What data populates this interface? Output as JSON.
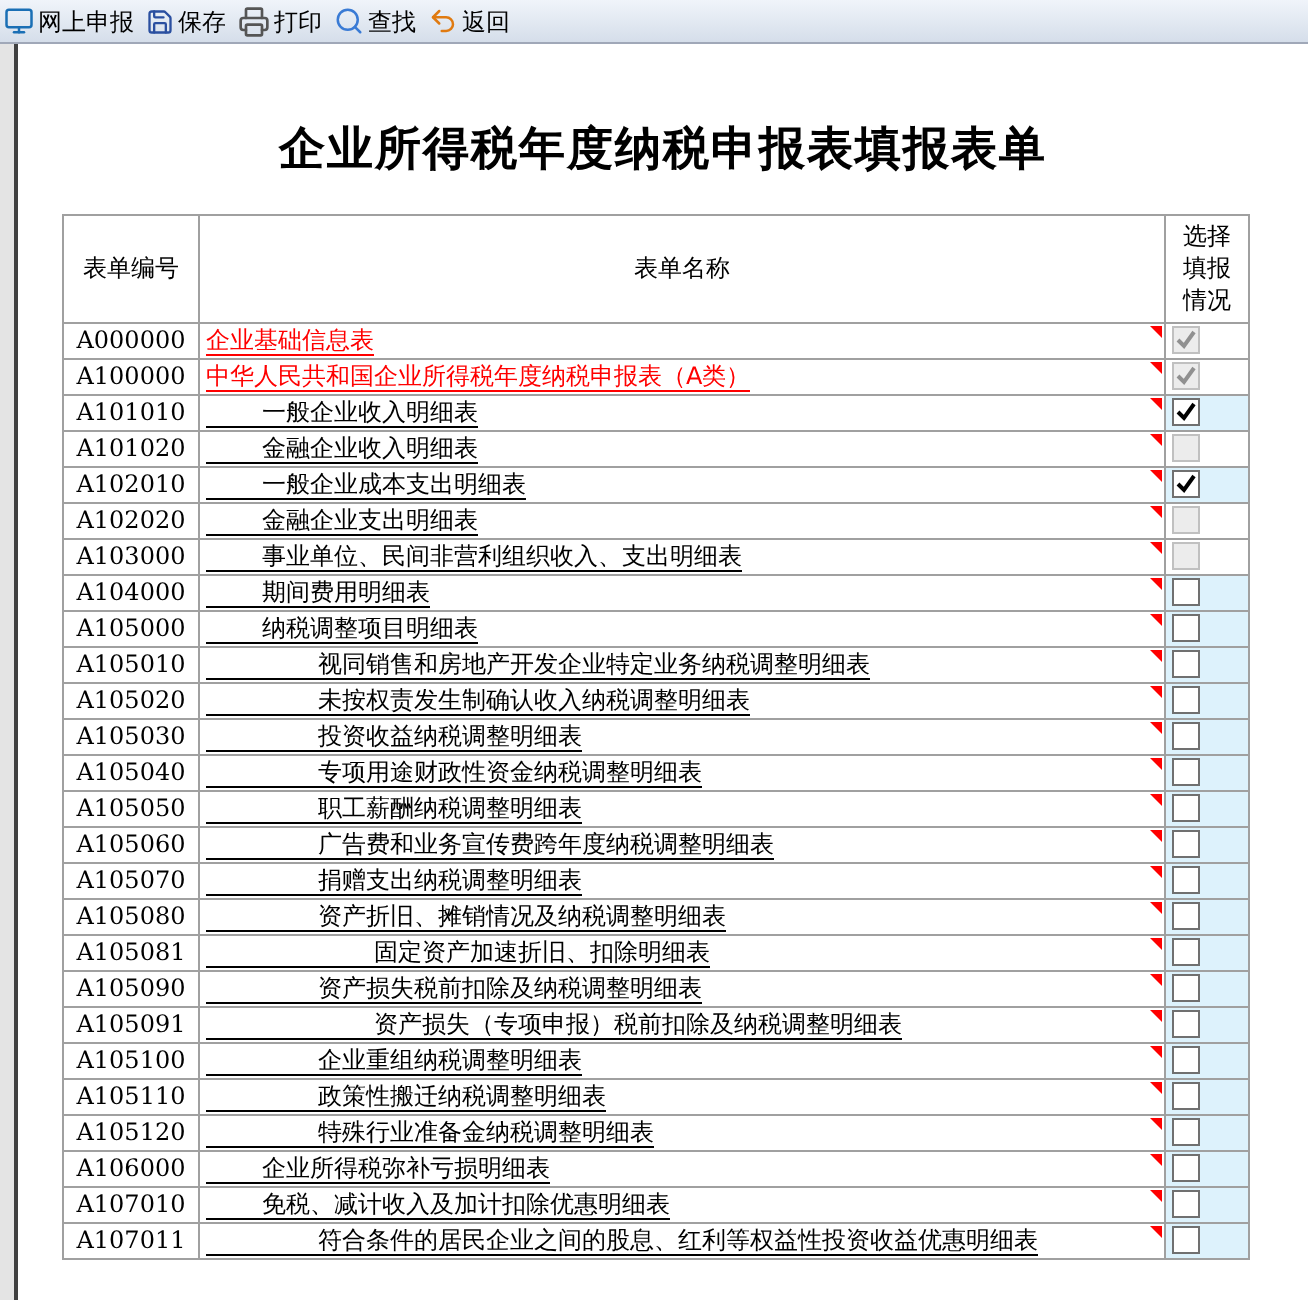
{
  "toolbar": [
    {
      "label": "网上申报",
      "kind": "submit"
    },
    {
      "label": "保存",
      "kind": "save"
    },
    {
      "label": "打印",
      "kind": "print"
    },
    {
      "label": "查找",
      "kind": "search"
    },
    {
      "label": "返回",
      "kind": "back"
    }
  ],
  "title": "企业所得税年度纳税申报表填报表单",
  "table": {
    "columns": [
      "表单编号",
      "表单名称",
      "选择填报情况"
    ],
    "rows": [
      {
        "code": "A000000",
        "name": "企业基础信息表",
        "checked": true,
        "disabled": true
      },
      {
        "code": "A100000",
        "name": "中华人民共和国企业所得税年度纳税申报表（A类）",
        "checked": true,
        "disabled": true,
        "children": [
          {
            "code": "A101010",
            "name": "一般企业收入明细表",
            "checked": true,
            "disabled": false
          },
          {
            "code": "A101020",
            "name": "金融企业收入明细表",
            "checked": false,
            "disabled": true
          },
          {
            "code": "A102010",
            "name": "一般企业成本支出明细表",
            "checked": true,
            "disabled": false
          },
          {
            "code": "A102020",
            "name": "金融企业支出明细表",
            "checked": false,
            "disabled": true
          },
          {
            "code": "A103000",
            "name": "事业单位、民间非营利组织收入、支出明细表",
            "checked": false,
            "disabled": true
          },
          {
            "code": "A104000",
            "name": "期间费用明细表",
            "checked": false,
            "disabled": false
          },
          {
            "code": "A105000",
            "name": "纳税调整项目明细表",
            "checked": false,
            "disabled": false,
            "children": [
              {
                "code": "A105010",
                "name": "视同销售和房地产开发企业特定业务纳税调整明细表",
                "checked": false,
                "disabled": false
              },
              {
                "code": "A105020",
                "name": "未按权责发生制确认收入纳税调整明细表",
                "checked": false,
                "disabled": false
              },
              {
                "code": "A105030",
                "name": "投资收益纳税调整明细表",
                "checked": false,
                "disabled": false
              },
              {
                "code": "A105040",
                "name": "专项用途财政性资金纳税调整明细表",
                "checked": false,
                "disabled": false
              },
              {
                "code": "A105050",
                "name": "职工薪酬纳税调整明细表",
                "checked": false,
                "disabled": false
              },
              {
                "code": "A105060",
                "name": "广告费和业务宣传费跨年度纳税调整明细表",
                "checked": false,
                "disabled": false
              },
              {
                "code": "A105070",
                "name": "捐赠支出纳税调整明细表",
                "checked": false,
                "disabled": false
              },
              {
                "code": "A105080",
                "name": "资产折旧、摊销情况及纳税调整明细表",
                "checked": false,
                "disabled": false,
                "children": [
                  {
                    "code": "A105081",
                    "name": "固定资产加速折旧、扣除明细表",
                    "checked": false,
                    "disabled": false
                  }
                ]
              },
              {
                "code": "A105090",
                "name": "资产损失税前扣除及纳税调整明细表",
                "checked": false,
                "disabled": false,
                "children": [
                  {
                    "code": "A105091",
                    "name": "资产损失（专项申报）税前扣除及纳税调整明细表",
                    "checked": false,
                    "disabled": false
                  }
                ]
              },
              {
                "code": "A105100",
                "name": "企业重组纳税调整明细表",
                "checked": false,
                "disabled": false
              },
              {
                "code": "A105110",
                "name": "政策性搬迁纳税调整明细表",
                "checked": false,
                "disabled": false
              },
              {
                "code": "A105120",
                "name": "特殊行业准备金纳税调整明细表",
                "checked": false,
                "disabled": false
              }
            ]
          },
          {
            "code": "A106000",
            "name": "企业所得税弥补亏损明细表",
            "checked": false,
            "disabled": false
          },
          {
            "code": "A107010",
            "name": "免税、减计收入及加计扣除优惠明细表",
            "checked": false,
            "disabled": false,
            "children": [
              {
                "code": "A107011",
                "name": "符合条件的居民企业之间的股息、红利等权益性投资收益优惠明细表",
                "checked": false,
                "disabled": false
              }
            ]
          }
        ]
      }
    ]
  }
}
